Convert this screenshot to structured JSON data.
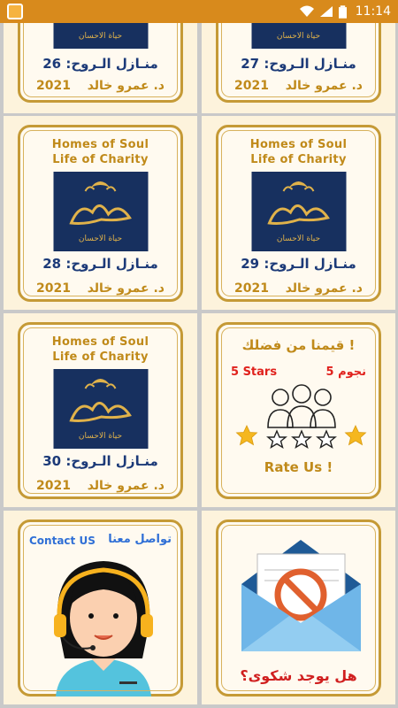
{
  "status_bar": {
    "time": "11:14",
    "icons": [
      "app-notification-icon",
      "wifi-icon",
      "signal-icon",
      "battery-icon"
    ]
  },
  "cards": [
    {
      "episode": "منـازل الـروح: 26",
      "author": "د. عمرو خالد",
      "year": "2021"
    },
    {
      "episode": "منـازل الـروح: 27",
      "author": "د. عمرو خالد",
      "year": "2021"
    },
    {
      "title_en_1": "Homes of Soul",
      "title_en_2": "Life of Charity",
      "episode": "منـازل الـروح: 28",
      "author": "د. عمرو خالد",
      "year": "2021"
    },
    {
      "title_en_1": "Homes of Soul",
      "title_en_2": "Life of Charity",
      "episode": "منـازل الـروح: 29",
      "author": "د. عمرو خالد",
      "year": "2021"
    },
    {
      "title_en_1": "Homes of Soul",
      "title_en_2": "Life of Charity",
      "episode": "منـازل الـروح: 30",
      "author": "د. عمرو خالد",
      "year": "2021"
    }
  ],
  "rate_card": {
    "title": "قيمنا من فضلك !",
    "stars_ar": "5 نجوم",
    "stars_en": "5 Stars",
    "cta": "Rate Us !"
  },
  "contact_card": {
    "label_en": "Contact US",
    "label_ar": "تواصل معنا"
  },
  "complaint_card": {
    "label": "هل يوجد شكوى؟"
  },
  "colors": {
    "status_bar": "#d88a1c",
    "gold": "#c08a1a",
    "navy": "#1c3a78",
    "red": "#e0211c",
    "blue": "#2f6fd6"
  }
}
